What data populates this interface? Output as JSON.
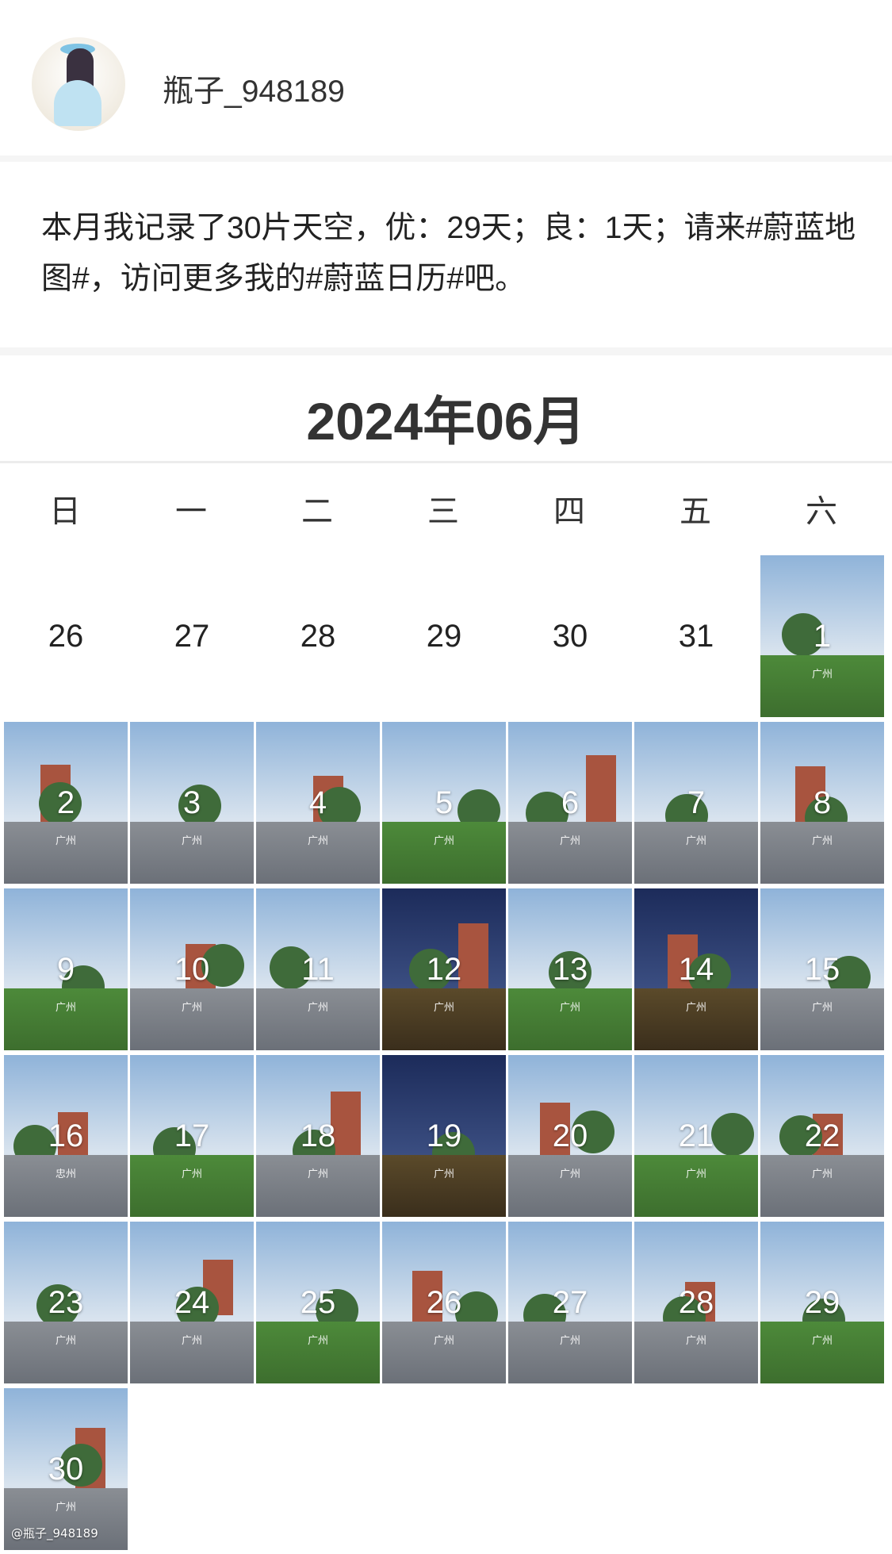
{
  "profile": {
    "username": "瓶子_948189"
  },
  "post": {
    "text": "本月我记录了30片天空，优：29天；良：1天；请来#蔚蓝地图#，访问更多我的#蔚蓝日历#吧。"
  },
  "calendar": {
    "title": "2024年06月",
    "weekdays": [
      "日",
      "一",
      "二",
      "三",
      "四",
      "五",
      "六"
    ],
    "leading_days": [
      "26",
      "27",
      "28",
      "29",
      "30",
      "31"
    ],
    "days": [
      "1",
      "2",
      "3",
      "4",
      "5",
      "6",
      "7",
      "8",
      "9",
      "10",
      "11",
      "12",
      "13",
      "14",
      "15",
      "16",
      "17",
      "18",
      "19",
      "20",
      "21",
      "22",
      "23",
      "24",
      "25",
      "26",
      "27",
      "28",
      "29",
      "30"
    ],
    "photo_city": "广州",
    "photo_city_16": "忠州",
    "night_days": [
      12,
      14,
      19
    ],
    "day_colors": {
      "sky_top": "#8fb3d9",
      "sky_bottom": "#d8e3ee",
      "ground": "#6b7078",
      "grass": "#4d8a3a",
      "night_sky": "#1c2b5a",
      "night_ground": "#5b4a2a"
    }
  },
  "watermark": "@瓶子_948189"
}
